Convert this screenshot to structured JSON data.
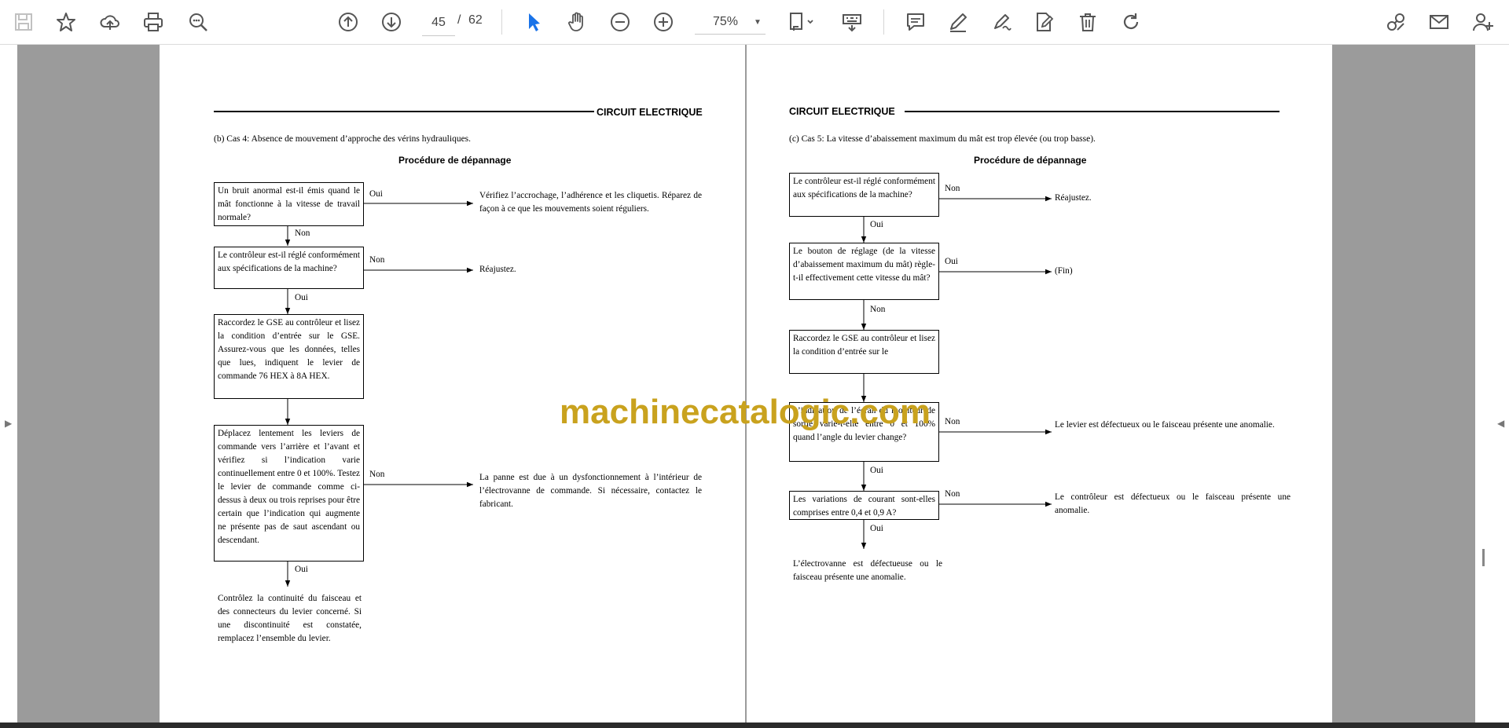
{
  "toolbar": {
    "current_page": "45",
    "page_separator": "/",
    "total_pages": "62",
    "zoom": "75%"
  },
  "icons": {
    "save": "save-icon",
    "bookmark": "star-icon",
    "upload": "cloud-upload-icon",
    "print": "printer-icon",
    "zoom_search": "zoom-marquee-icon",
    "prev_page": "arrow-up-circle-icon",
    "next_page": "arrow-down-circle-icon",
    "select": "cursor-arrow-icon",
    "hand": "hand-icon",
    "zoom_out": "zoom-out-icon",
    "zoom_in": "zoom-in-icon",
    "page_fit": "page-fit-icon",
    "keyboard": "keyboard-icon",
    "comment": "comment-icon",
    "pen": "pen-icon",
    "highlight": "highlighter-icon",
    "edit": "edit-icon",
    "trash": "trash-icon",
    "redo": "redo-icon",
    "share": "share-link-icon",
    "mail": "mail-icon",
    "add_user": "add-user-icon"
  },
  "colors": {
    "accent": "#1a73e8",
    "viewer_bg": "#9b9b9b",
    "watermark": "#c9a21e"
  },
  "watermark": "machinecatalogic.com",
  "left_page": {
    "header": "CIRCUIT ELECTRIQUE",
    "case_title": "(b)  Cas 4: Absence de mouvement d’approche des vérins hydrauliques.",
    "procedure_title": "Procédure de dépannage",
    "boxes": [
      "Un bruit anormal est-il émis quand le mât fonctionne à la vitesse de travail normale?",
      "Le contrôleur est-il réglé conformément aux spécifications de la machine?",
      "Raccordez le GSE au contrôleur et lisez la condition d’entrée sur le GSE. Assurez-vous que les données, telles que lues, indiquent le levier de commande 76 HEX à 8A HEX.",
      "Déplacez lentement les leviers de commande vers l’arrière et l’avant et vérifiez si l’indication varie continuellement entre 0 et 100%. Testez le levier de commande comme ci-dessus à deux ou trois reprises pour être certain que l’indication qui augmente ne présente pas de saut ascendant ou descendant."
    ],
    "labels": [
      "Oui",
      "Non",
      "Non",
      "Oui",
      "Non",
      "Oui"
    ],
    "results": [
      "Vérifiez l’accrochage, l’adhérence et les cliquetis. Réparez de façon à ce que les mouvements soient réguliers.",
      "Réajustez.",
      "La panne est due à un dysfonctionnement à l’intérieur de l’électrovanne de commande. Si nécessaire, contactez le fabricant.",
      "Contrôlez la continuité du faisceau et des connecteurs du levier concerné. Si une discontinuité est constatée, remplacez l’ensemble du levier."
    ]
  },
  "right_page": {
    "header": "CIRCUIT ELECTRIQUE",
    "case_title": "(c)  Cas 5: La vitesse d’abaissement maximum du mât est trop élevée (ou trop basse).",
    "procedure_title": "Procédure de dépannage",
    "boxes": [
      "Le contrôleur est-il réglé conformément aux spécifications de la machine?",
      "Le bouton de réglage (de la vitesse d’abaissement maximum du mât) règle-t-il effectivement cette vitesse du mât?",
      "Raccordez le GSE au contrôleur et lisez la condition d’entrée sur le",
      "L’indication de l’écran du moniteur de sortie varie-t-elle entre 0 et 100% quand l’angle du levier change?",
      "Les variations de courant sont-elles comprises entre 0,4 et 0,9 A?"
    ],
    "labels": [
      "Non",
      "Oui",
      "Oui",
      "Non",
      "Non",
      "Oui",
      "Non",
      "Oui"
    ],
    "results": [
      "Réajustez.",
      "(Fin)",
      "Le levier est défectueux ou le faisceau présente une anomalie.",
      "Le contrôleur est défectueux ou le faisceau présente une anomalie.",
      "L’électrovanne est défectueuse ou le faisceau présente une anomalie."
    ]
  }
}
